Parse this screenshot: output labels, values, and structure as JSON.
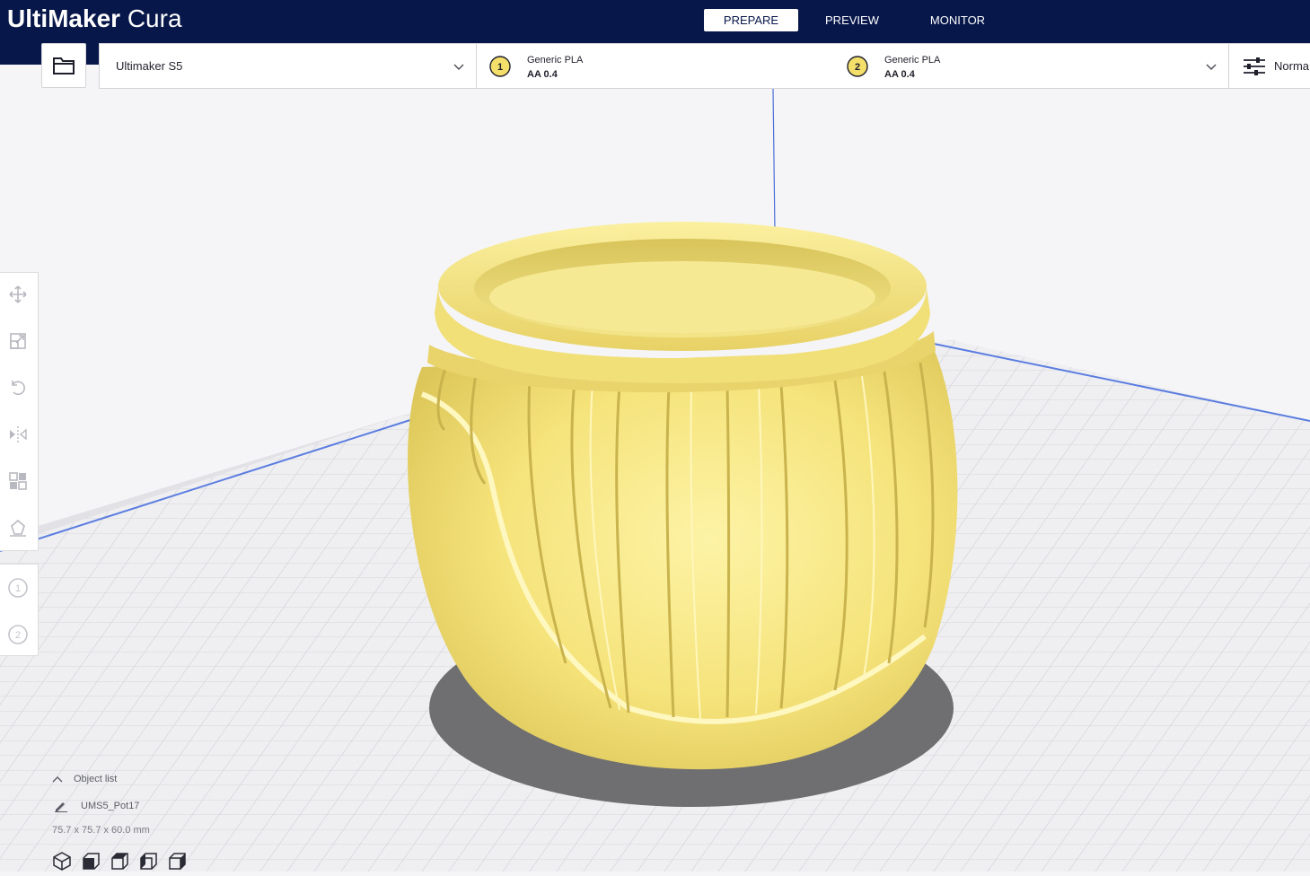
{
  "app": {
    "logo_bold": "UltiMaker",
    "logo_light": "Cura"
  },
  "stages": [
    {
      "label": "PREPARE",
      "active": true
    },
    {
      "label": "PREVIEW",
      "active": false
    },
    {
      "label": "MONITOR",
      "active": false
    }
  ],
  "toolbar": {
    "printer": "Ultimaker S5",
    "extruders": [
      {
        "number": "1",
        "material": "Generic PLA",
        "core": "AA 0.4"
      },
      {
        "number": "2",
        "material": "Generic PLA",
        "core": "AA 0.4"
      }
    ],
    "print_profile": "Norma"
  },
  "tools": {
    "transform": [
      "move-icon",
      "scale-icon",
      "rotate-icon",
      "mirror-icon",
      "per-model-settings-icon",
      "support-blocker-icon"
    ],
    "extruder_select": [
      "1",
      "2"
    ]
  },
  "object_list": {
    "toggle_label": "Object list",
    "object_name": "UMS5_Pot17",
    "dimensions": "75.7 x 75.7 x 60.0 mm"
  },
  "view_buttons": [
    "3d-view-icon",
    "front-view-icon",
    "top-view-icon",
    "left-view-icon",
    "right-view-icon"
  ],
  "colors": {
    "header_bg": "#07174a",
    "model_yellow": "#f7e98a",
    "buildplate_grid": "#d8d8dc",
    "accent_blue": "#3b5fd1"
  }
}
